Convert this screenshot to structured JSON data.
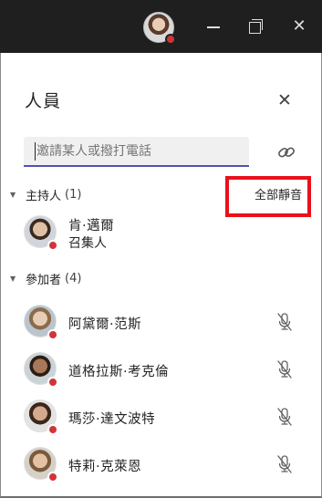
{
  "titlebar": {
    "avatar_icon": "user-avatar",
    "status_color": "#d13438",
    "min_icon": "minimize-icon",
    "restore_icon": "restore-icon",
    "close_glyph": "✕"
  },
  "panel": {
    "title": "人員",
    "close_glyph": "✕",
    "invite_placeholder": "邀請某人或撥打電話",
    "link_icon": "link-icon"
  },
  "hosts": {
    "label": "主持人",
    "count": "(1)",
    "mute_all": "全部靜音",
    "people": [
      {
        "name": "肯·邁爾",
        "role": "召集人",
        "status_color": "#d13438"
      }
    ]
  },
  "attendees": {
    "label": "參加者",
    "count": "(4)",
    "people": [
      {
        "name": "阿黛爾·范斯",
        "mic_icon": "mic-off-icon",
        "status_color": "#d13438"
      },
      {
        "name": "道格拉斯·考克倫",
        "mic_icon": "mic-off-icon",
        "status_color": "#d13438"
      },
      {
        "name": "瑪莎·達文波特",
        "mic_icon": "mic-off-icon",
        "status_color": "#d13438"
      },
      {
        "name": "特莉·克萊恩",
        "mic_icon": "mic-off-icon",
        "status_color": "#d13438"
      }
    ]
  },
  "colors": {
    "accent": "#4f52b2",
    "highlight": "#e8111b",
    "titlebar": "#1f1f1f"
  }
}
